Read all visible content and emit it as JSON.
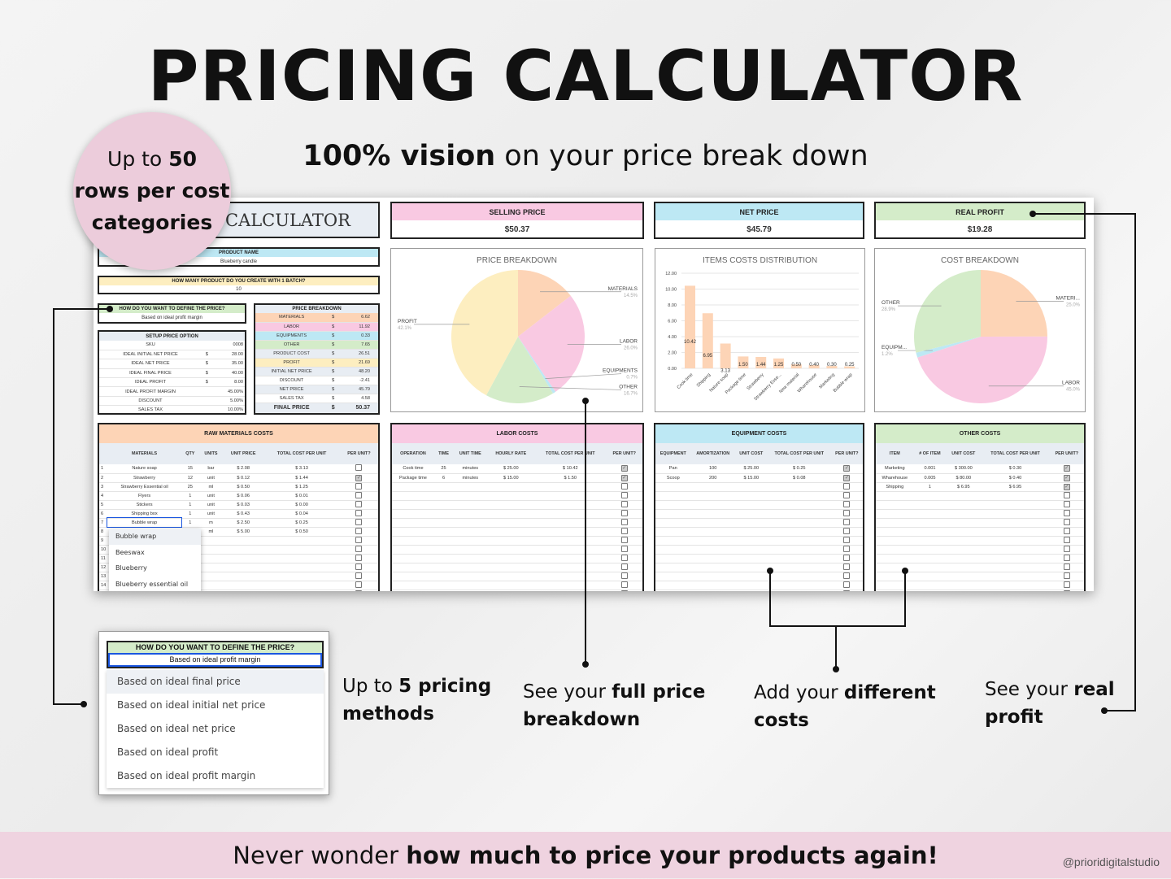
{
  "colors": {
    "materials": "#fdd4b6",
    "labor": "#f9c9e2",
    "equipment": "#bde8f4",
    "other": "#d4ecc9",
    "profit": "#fdeec0",
    "badge": "#ecccdb"
  },
  "title": "PRICING CALCULATOR",
  "subtitle_bold": "100% vision",
  "subtitle_rest": " on your price break down",
  "badge": {
    "l1a": "Up to ",
    "l1b": "50",
    "l2": "rows per cost",
    "l3": "categories"
  },
  "calc_title": "CALCULATOR",
  "product": {
    "label": "PRODUCT NAME",
    "value": "Blueberry candle"
  },
  "batch": {
    "label": "HOW MANY PRODUCT DO YOU CREATE WITH 1 BATCH?",
    "value": "10"
  },
  "define": {
    "label": "HOW DO YOU WANT TO DEFINE THE PRICE?",
    "value": "Based on ideal profit margin"
  },
  "setup": {
    "label": "SETUP PRICE OPTION",
    "rows": [
      [
        "SKU",
        "",
        "0008"
      ],
      [
        "IDEAL INITIAL NET PRICE",
        "$",
        "28.00"
      ],
      [
        "IDEAL NET PRICE",
        "$",
        "35.00"
      ],
      [
        "IDEAL FINAL PRICE",
        "$",
        "40.00"
      ],
      [
        "IDEAL PROFIT",
        "$",
        "8.00"
      ],
      [
        "IDEAL PROFIT MARGIN",
        "",
        "45.00%"
      ],
      [
        "DISCOUNT",
        "",
        "5.00%"
      ],
      [
        "SALES TAX",
        "",
        "10.00%"
      ]
    ]
  },
  "breakdown": {
    "label": "PRICE BREAKDOWN",
    "rows": [
      [
        "MATERIALS",
        "$",
        "6.62"
      ],
      [
        "LABOR",
        "$",
        "11.92"
      ],
      [
        "EQUIPMENTS",
        "$",
        "0.33"
      ],
      [
        "OTHER",
        "$",
        "7.65"
      ],
      [
        "PRODUCT COST",
        "$",
        "26.51"
      ],
      [
        "PROFIT",
        "$",
        "21.69"
      ],
      [
        "INITIAL NET PRICE",
        "$",
        "48.20"
      ],
      [
        "DISCOUNT",
        "$",
        "-2.41"
      ],
      [
        "NET PRICE",
        "$",
        "45.79"
      ],
      [
        "SALES TAX",
        "$",
        "4.58"
      ],
      [
        "FINAL PRICE",
        "$",
        "50.37"
      ]
    ]
  },
  "kpis": [
    {
      "label": "SELLING PRICE",
      "value": "$50.37"
    },
    {
      "label": "NET PRICE",
      "value": "$45.79"
    },
    {
      "label": "REAL PROFIT",
      "value": "$19.28"
    }
  ],
  "chart_data": [
    {
      "type": "pie",
      "title": "PRICE BREAKDOWN",
      "labels": [
        "MATERIALS",
        "LABOR",
        "EQUIPMENTS",
        "OTHER",
        "PROFIT"
      ],
      "values": [
        14.5,
        26.0,
        0.7,
        16.7,
        42.1
      ],
      "pct_labels": [
        "14.5%",
        "26.0%",
        "0.7%",
        "16.7%",
        "42.1%"
      ]
    },
    {
      "type": "bar",
      "title": "ITEMS COSTS DISTRIBUTION",
      "categories": [
        "Cook time",
        "Shipping",
        "Nature soap",
        "Package time",
        "Strawberry",
        "Strawberry Esse...",
        "New material",
        "Wharehouse",
        "Marketing",
        "Bubble wrap"
      ],
      "values": [
        10.42,
        6.95,
        3.13,
        1.5,
        1.44,
        1.25,
        0.5,
        0.4,
        0.3,
        0.25
      ],
      "data_labels": [
        "10.42",
        "6.95",
        "3.13",
        "1.50",
        "1.44",
        "1.25",
        "0.50",
        "0.40",
        "0.30",
        "0.25"
      ],
      "ylim": [
        0,
        12
      ],
      "yticks": [
        "0.00",
        "2.00",
        "4.00",
        "6.00",
        "8.00",
        "10.00",
        "12.00"
      ],
      "grid": true
    },
    {
      "type": "pie",
      "title": "COST BREAKDOWN",
      "labels": [
        "MATERI...",
        "LABOR",
        "EQUIPM...",
        "OTHER"
      ],
      "values": [
        25.0,
        45.0,
        1.2,
        28.9
      ],
      "pct_labels": [
        "25.0%",
        "45.0%",
        "1.2%",
        "28.9%"
      ]
    }
  ],
  "tables": {
    "raw": {
      "title": "RAW MATERIALS COSTS",
      "cols": [
        "",
        "MATERIALS",
        "QTY",
        "UNITS",
        "UNIT PRICE",
        "TOTAL COST PER UNIT",
        "PER UNIT?"
      ],
      "rows": [
        [
          "1",
          "Nature soap",
          "15",
          "bar",
          "$ 2.08",
          "$ 3.13",
          false
        ],
        [
          "2",
          "Strawberry",
          "12",
          "unit",
          "$ 0.12",
          "$ 1.44",
          true
        ],
        [
          "3",
          "Strawberry Essential oil",
          "25",
          "ml",
          "$ 0.50",
          "$ 1.25",
          false
        ],
        [
          "4",
          "Flyers",
          "1",
          "unit",
          "$ 0.06",
          "$ 0.01",
          false
        ],
        [
          "5",
          "Stickers",
          "1",
          "unit",
          "$ 0.03",
          "$ 0.00",
          false
        ],
        [
          "6",
          "Shipping box",
          "1",
          "unit",
          "$ 0.43",
          "$ 0.04",
          false
        ],
        [
          "7",
          "Bubble wrap",
          "1",
          "m",
          "$ 2.50",
          "$ 0.25",
          false
        ],
        [
          "8",
          "",
          "",
          "ml",
          "$ 5.00",
          "$ 0.50",
          false
        ],
        [
          "9",
          "",
          "",
          "",
          "",
          "",
          false
        ],
        [
          "10",
          "",
          "",
          "",
          "",
          "",
          false
        ],
        [
          "11",
          "",
          "",
          "",
          "",
          "",
          false
        ],
        [
          "12",
          "",
          "",
          "",
          "",
          "",
          false
        ],
        [
          "13",
          "",
          "",
          "",
          "",
          "",
          false
        ],
        [
          "14",
          "",
          "",
          "",
          "",
          "",
          false
        ]
      ],
      "dropdown": [
        "Bubble wrap",
        "Beeswax",
        "Blueberry",
        "Blueberry essential oil"
      ]
    },
    "labor": {
      "title": "LABOR COSTS",
      "cols": [
        "OPERATION",
        "TIME",
        "UNIT TIME",
        "HOURLY RATE",
        "TOTAL COST PER UNIT",
        "PER UNIT?"
      ],
      "rows": [
        [
          "Cook time",
          "25",
          "minutes",
          "$ 25.00",
          "$ 10.42",
          true
        ],
        [
          "Package time",
          "6",
          "minutes",
          "$ 15.00",
          "$ 1.50",
          true
        ]
      ]
    },
    "equipment": {
      "title": "EQUIPMENT COSTS",
      "cols": [
        "EQUIPMENT",
        "AMORTIZATION",
        "UNIT COST",
        "TOTAL COST PER UNIT",
        "PER UNIT?"
      ],
      "rows": [
        [
          "Pan",
          "100",
          "$ 25.00",
          "$ 0.25",
          true
        ],
        [
          "Scoop",
          "200",
          "$ 15.00",
          "$ 0.08",
          true
        ]
      ]
    },
    "other": {
      "title": "OTHER COSTS",
      "cols": [
        "ITEM",
        "# OF ITEM",
        "UNIT COST",
        "TOTAL COST PER UNIT",
        "PER UNIT?"
      ],
      "rows": [
        [
          "Marketing",
          "0.001",
          "$ 300.00",
          "$ 0.30",
          true
        ],
        [
          "Wharehouse",
          "0.005",
          "$ 80.00",
          "$ 0.40",
          true
        ],
        [
          "Shipping",
          "1",
          "$ 6.95",
          "$ 6.95",
          true
        ]
      ]
    }
  },
  "dropdown_zoom": {
    "label": "HOW DO YOU WANT TO DEFINE THE PRICE?",
    "selected": "Based on ideal profit margin",
    "options": [
      "Based on ideal final price",
      "Based on ideal initial net price",
      "Based on ideal net price",
      "Based on ideal profit",
      "Based on ideal profit margin"
    ]
  },
  "captions": {
    "c1": {
      "a": "Up to ",
      "b": "5 pricing",
      "c": "methods"
    },
    "c2": {
      "a": "See your ",
      "b": "full price",
      "c": "breakdown"
    },
    "c3": {
      "a": "Add your ",
      "b": "different",
      "c": "costs"
    },
    "c4": {
      "a": "See your ",
      "b": "real",
      "c": "profit"
    }
  },
  "footer": {
    "a": "Never wonder ",
    "b": "how much to price your products again!"
  },
  "handle": "@prioridigitalstudio"
}
